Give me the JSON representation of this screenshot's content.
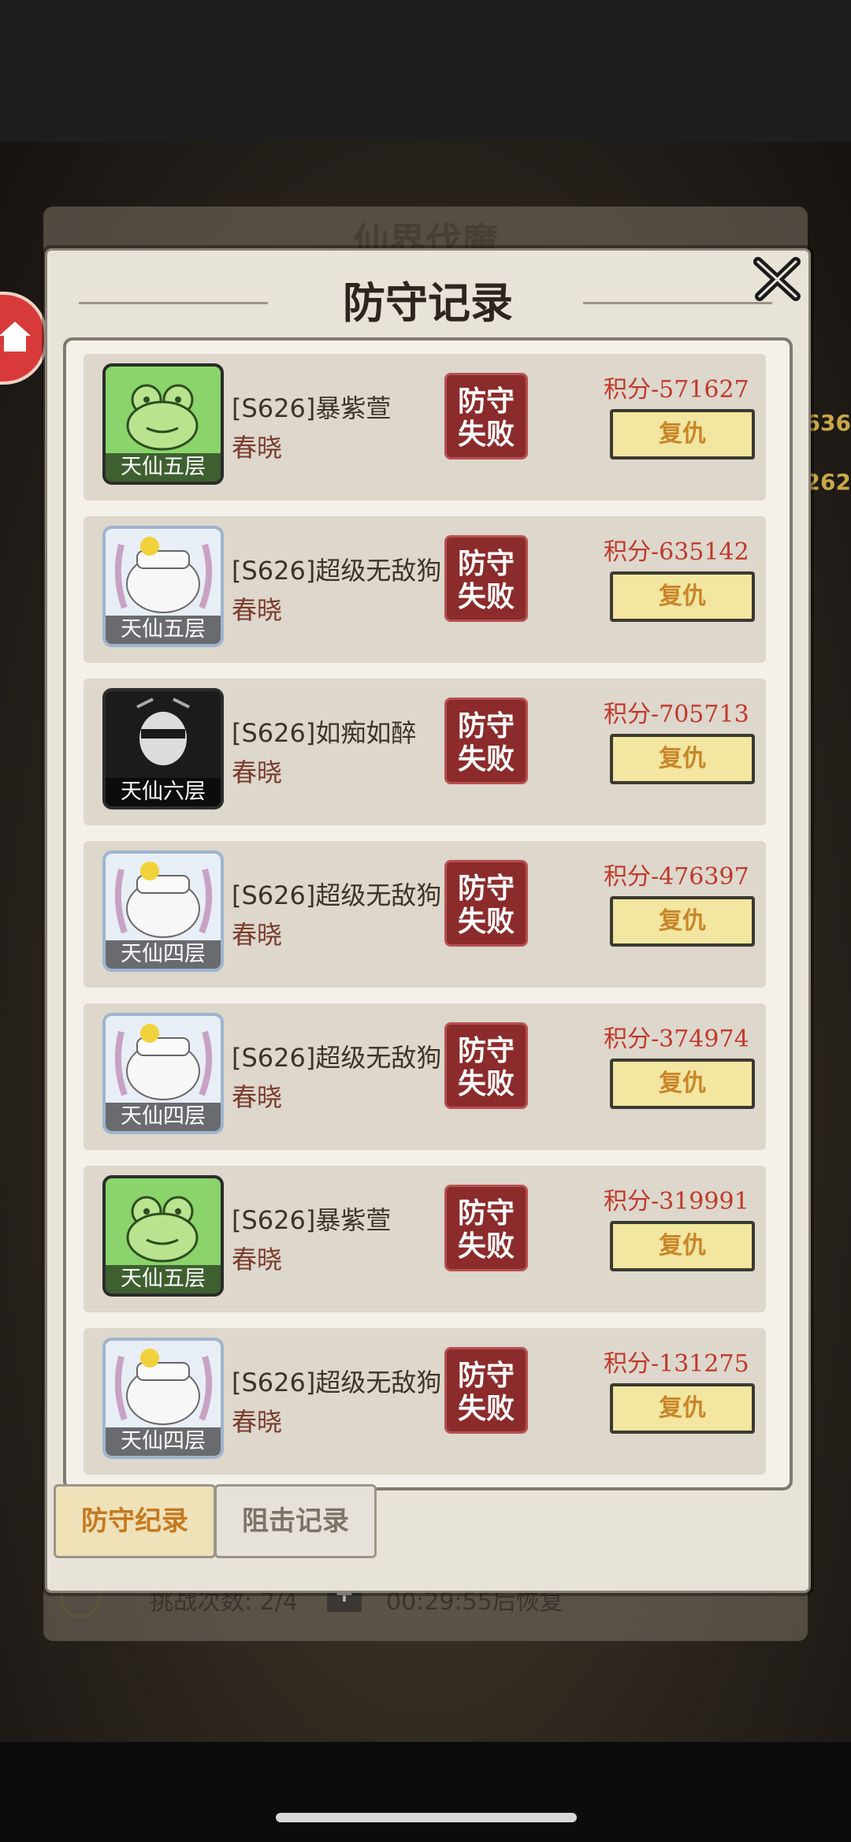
{
  "behind": {
    "title": "仙界伐魔",
    "challenge_text": "挑战次数: 2/4",
    "plus": "+",
    "timer_text": "00:29:55后恢复",
    "side_numbers": [
      "636",
      "262"
    ]
  },
  "dialog": {
    "title": "防守记录",
    "close": "✕"
  },
  "records": [
    {
      "avatar": "frog",
      "rank": "天仙五层",
      "name": "[S626]暴紫萱",
      "guild": "春晓",
      "stamp_line1": "防守",
      "stamp_line2": "失败",
      "score": "积分-571627",
      "revenge": "复仇"
    },
    {
      "avatar": "pika",
      "rank": "天仙五层",
      "name": "[S626]超级无敌狗",
      "guild": "春晓",
      "stamp_line1": "防守",
      "stamp_line2": "失败",
      "score": "积分-635142",
      "revenge": "复仇"
    },
    {
      "avatar": "ninja",
      "rank": "天仙六层",
      "name": "[S626]如痴如醉",
      "guild": "春晓",
      "stamp_line1": "防守",
      "stamp_line2": "失败",
      "score": "积分-705713",
      "revenge": "复仇"
    },
    {
      "avatar": "pika",
      "rank": "天仙四层",
      "name": "[S626]超级无敌狗",
      "guild": "春晓",
      "stamp_line1": "防守",
      "stamp_line2": "失败",
      "score": "积分-476397",
      "revenge": "复仇"
    },
    {
      "avatar": "pika",
      "rank": "天仙四层",
      "name": "[S626]超级无敌狗",
      "guild": "春晓",
      "stamp_line1": "防守",
      "stamp_line2": "失败",
      "score": "积分-374974",
      "revenge": "复仇"
    },
    {
      "avatar": "frog",
      "rank": "天仙五层",
      "name": "[S626]暴紫萱",
      "guild": "春晓",
      "stamp_line1": "防守",
      "stamp_line2": "失败",
      "score": "积分-319991",
      "revenge": "复仇"
    },
    {
      "avatar": "pika",
      "rank": "天仙四层",
      "name": "[S626]超级无敌狗",
      "guild": "春晓",
      "stamp_line1": "防守",
      "stamp_line2": "失败",
      "score": "积分-131275",
      "revenge": "复仇"
    }
  ],
  "tabs": {
    "defense": "防守纪录",
    "intercept": "阻击记录"
  },
  "colors": {
    "stamp": "#8c2b2b",
    "score": "#c0392b",
    "revenge_bg": "#f2e6a0",
    "revenge_text": "#c9862a"
  }
}
